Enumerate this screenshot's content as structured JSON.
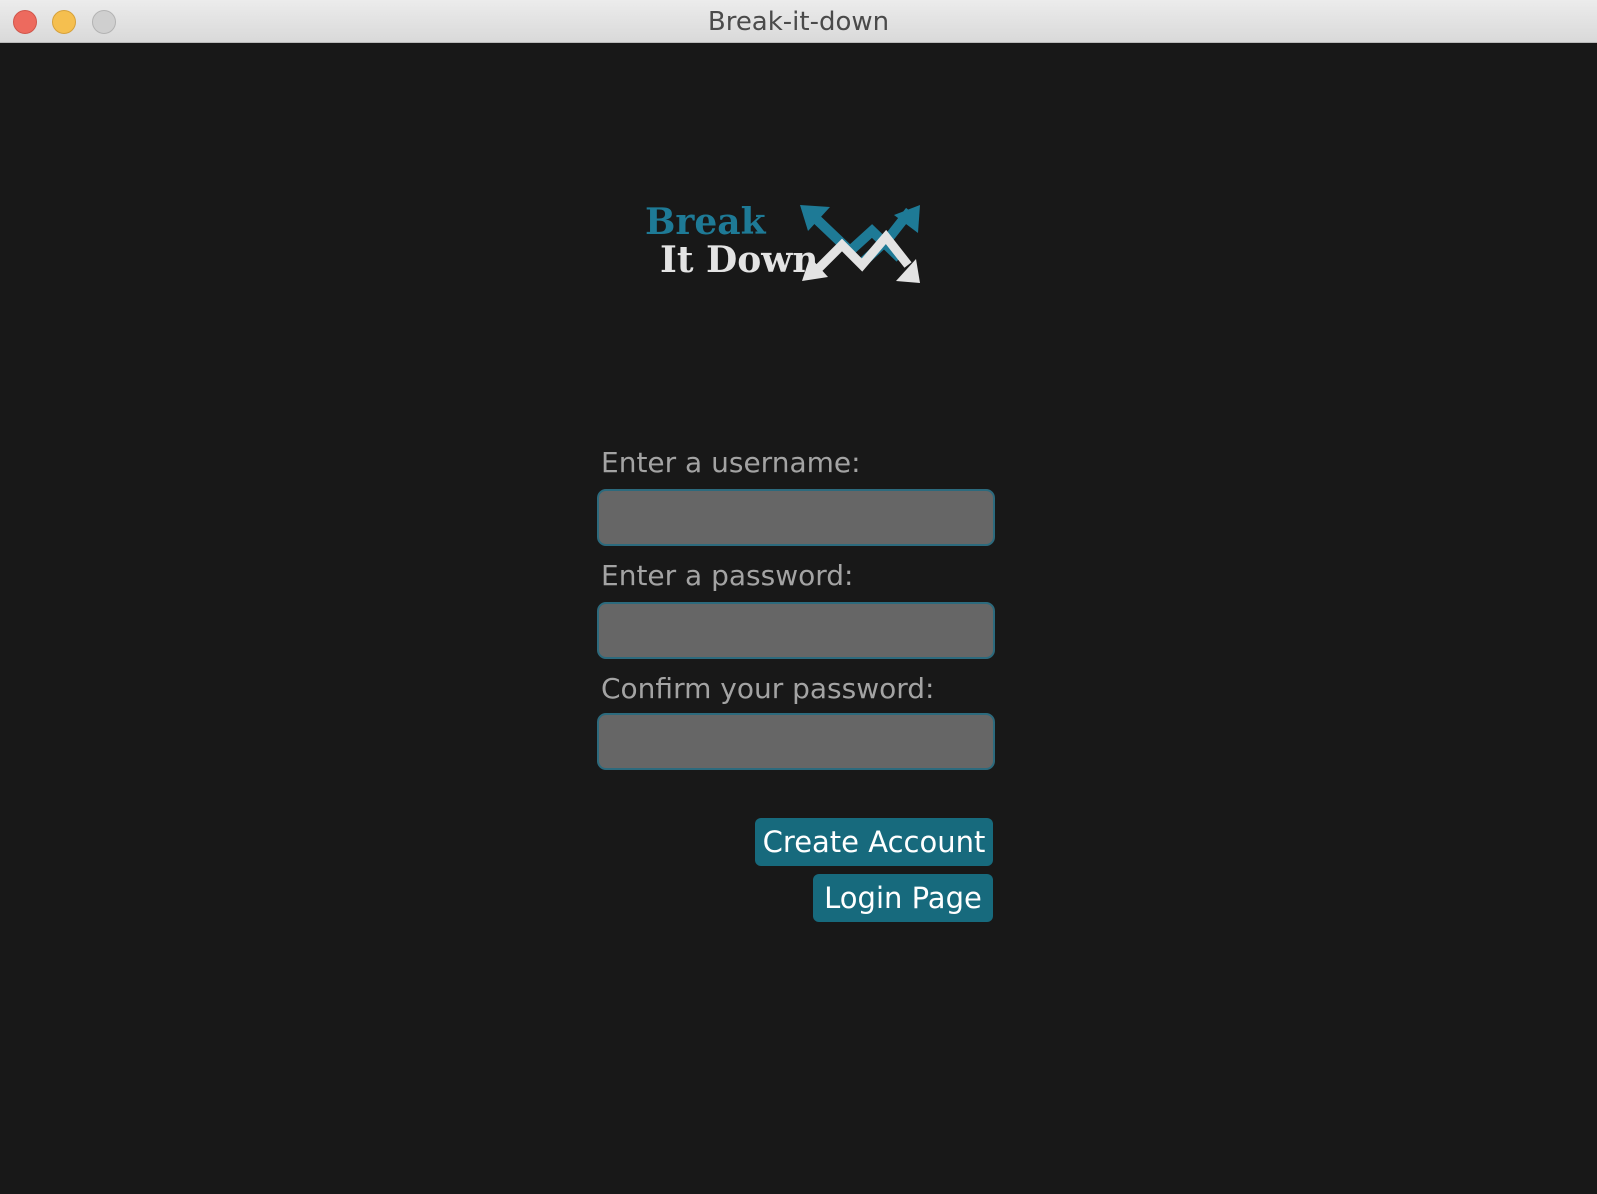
{
  "window": {
    "title": "Break-it-down"
  },
  "logo": {
    "line1": "Break",
    "line2": "It Down",
    "icon": "arrows-zigzag-icon"
  },
  "form": {
    "username_label": "Enter a username:",
    "username_value": "",
    "password_label": "Enter a password:",
    "password_value": "",
    "confirm_label": "Confirm your password:",
    "confirm_value": ""
  },
  "buttons": {
    "create_account": "Create Account",
    "login_page": "Login Page"
  },
  "colors": {
    "background": "#181818",
    "accent": "#176a7d",
    "field_fill": "#666666",
    "label_text": "#a3a3a3"
  }
}
